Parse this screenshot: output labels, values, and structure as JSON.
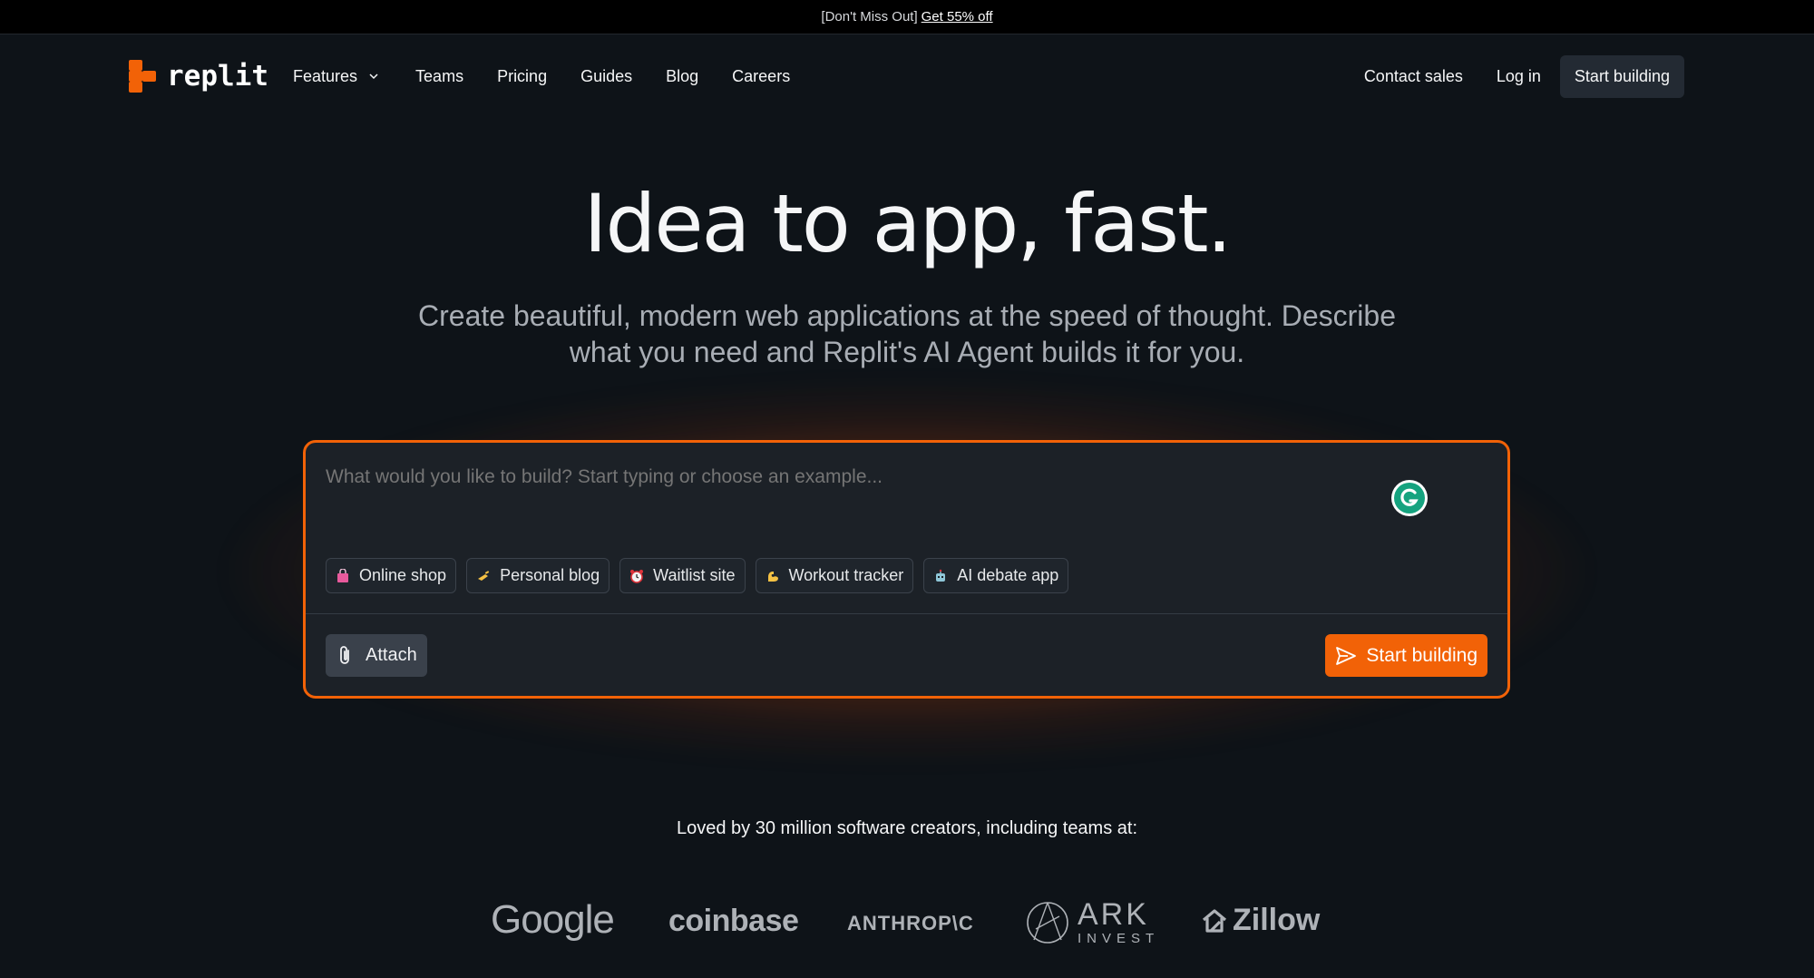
{
  "promo": {
    "prefix": "[Don't Miss Out]",
    "link": "Get 55% off"
  },
  "nav": {
    "brand": "replit",
    "links": [
      "Features",
      "Teams",
      "Pricing",
      "Guides",
      "Blog",
      "Careers"
    ],
    "contact_sales": "Contact sales",
    "log_in": "Log in",
    "start_building": "Start building"
  },
  "hero": {
    "title": "Idea to app, fast.",
    "subtitle": "Create beautiful, modern web applications at the speed of thought. Describe what you need and Replit's AI Agent builds it for you."
  },
  "prompt_card": {
    "placeholder": "What would you like to build? Start typing or choose an example...",
    "examples": [
      {
        "icon": "shopping-bag-icon",
        "label": "Online shop"
      },
      {
        "icon": "writing-hand-icon",
        "label": "Personal blog"
      },
      {
        "icon": "alarm-clock-icon",
        "label": "Waitlist site"
      },
      {
        "icon": "flexed-biceps-icon",
        "label": "Workout tracker"
      },
      {
        "icon": "robot-icon",
        "label": "AI debate app"
      }
    ],
    "attach_label": "Attach",
    "submit_label": "Start building"
  },
  "social_proof": {
    "headline": "Loved by 30 million software creators, including teams at:",
    "logos": [
      "Google",
      "coinbase",
      "ANTHROP\\C",
      "ARK",
      "INVEST",
      "Zillow"
    ]
  },
  "colors": {
    "accent": "#f26207",
    "background": "#0e1318",
    "card": "#1c2127"
  }
}
